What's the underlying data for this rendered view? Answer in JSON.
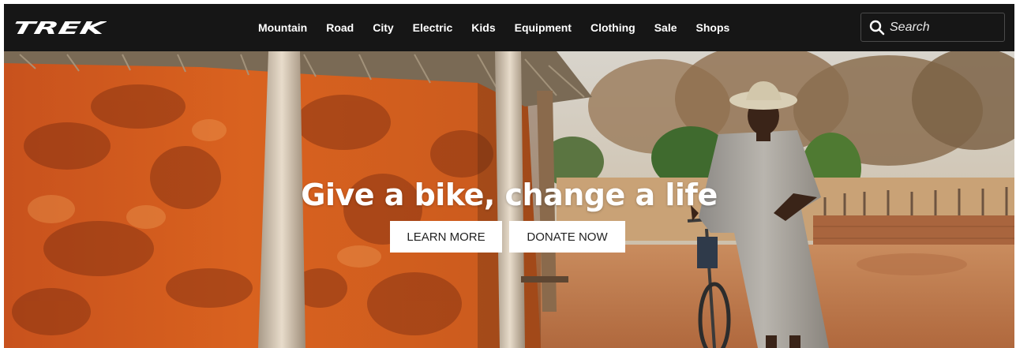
{
  "brand": {
    "logo_text": "TREK"
  },
  "nav": {
    "items": [
      {
        "label": "Mountain"
      },
      {
        "label": "Road"
      },
      {
        "label": "City"
      },
      {
        "label": "Electric"
      },
      {
        "label": "Kids"
      },
      {
        "label": "Equipment"
      },
      {
        "label": "Clothing"
      },
      {
        "label": "Sale"
      },
      {
        "label": "Shops"
      }
    ]
  },
  "search": {
    "placeholder": "Search",
    "value": "",
    "icon": "search-icon"
  },
  "hero": {
    "headline": "Give a bike, change a life",
    "buttons": {
      "learn_more": "LEARN MORE",
      "donate_now": "DONATE NOW"
    }
  },
  "colors": {
    "header_bg": "#161616",
    "nav_text": "#ffffff",
    "button_bg": "#ffffff",
    "button_text": "#222222"
  }
}
